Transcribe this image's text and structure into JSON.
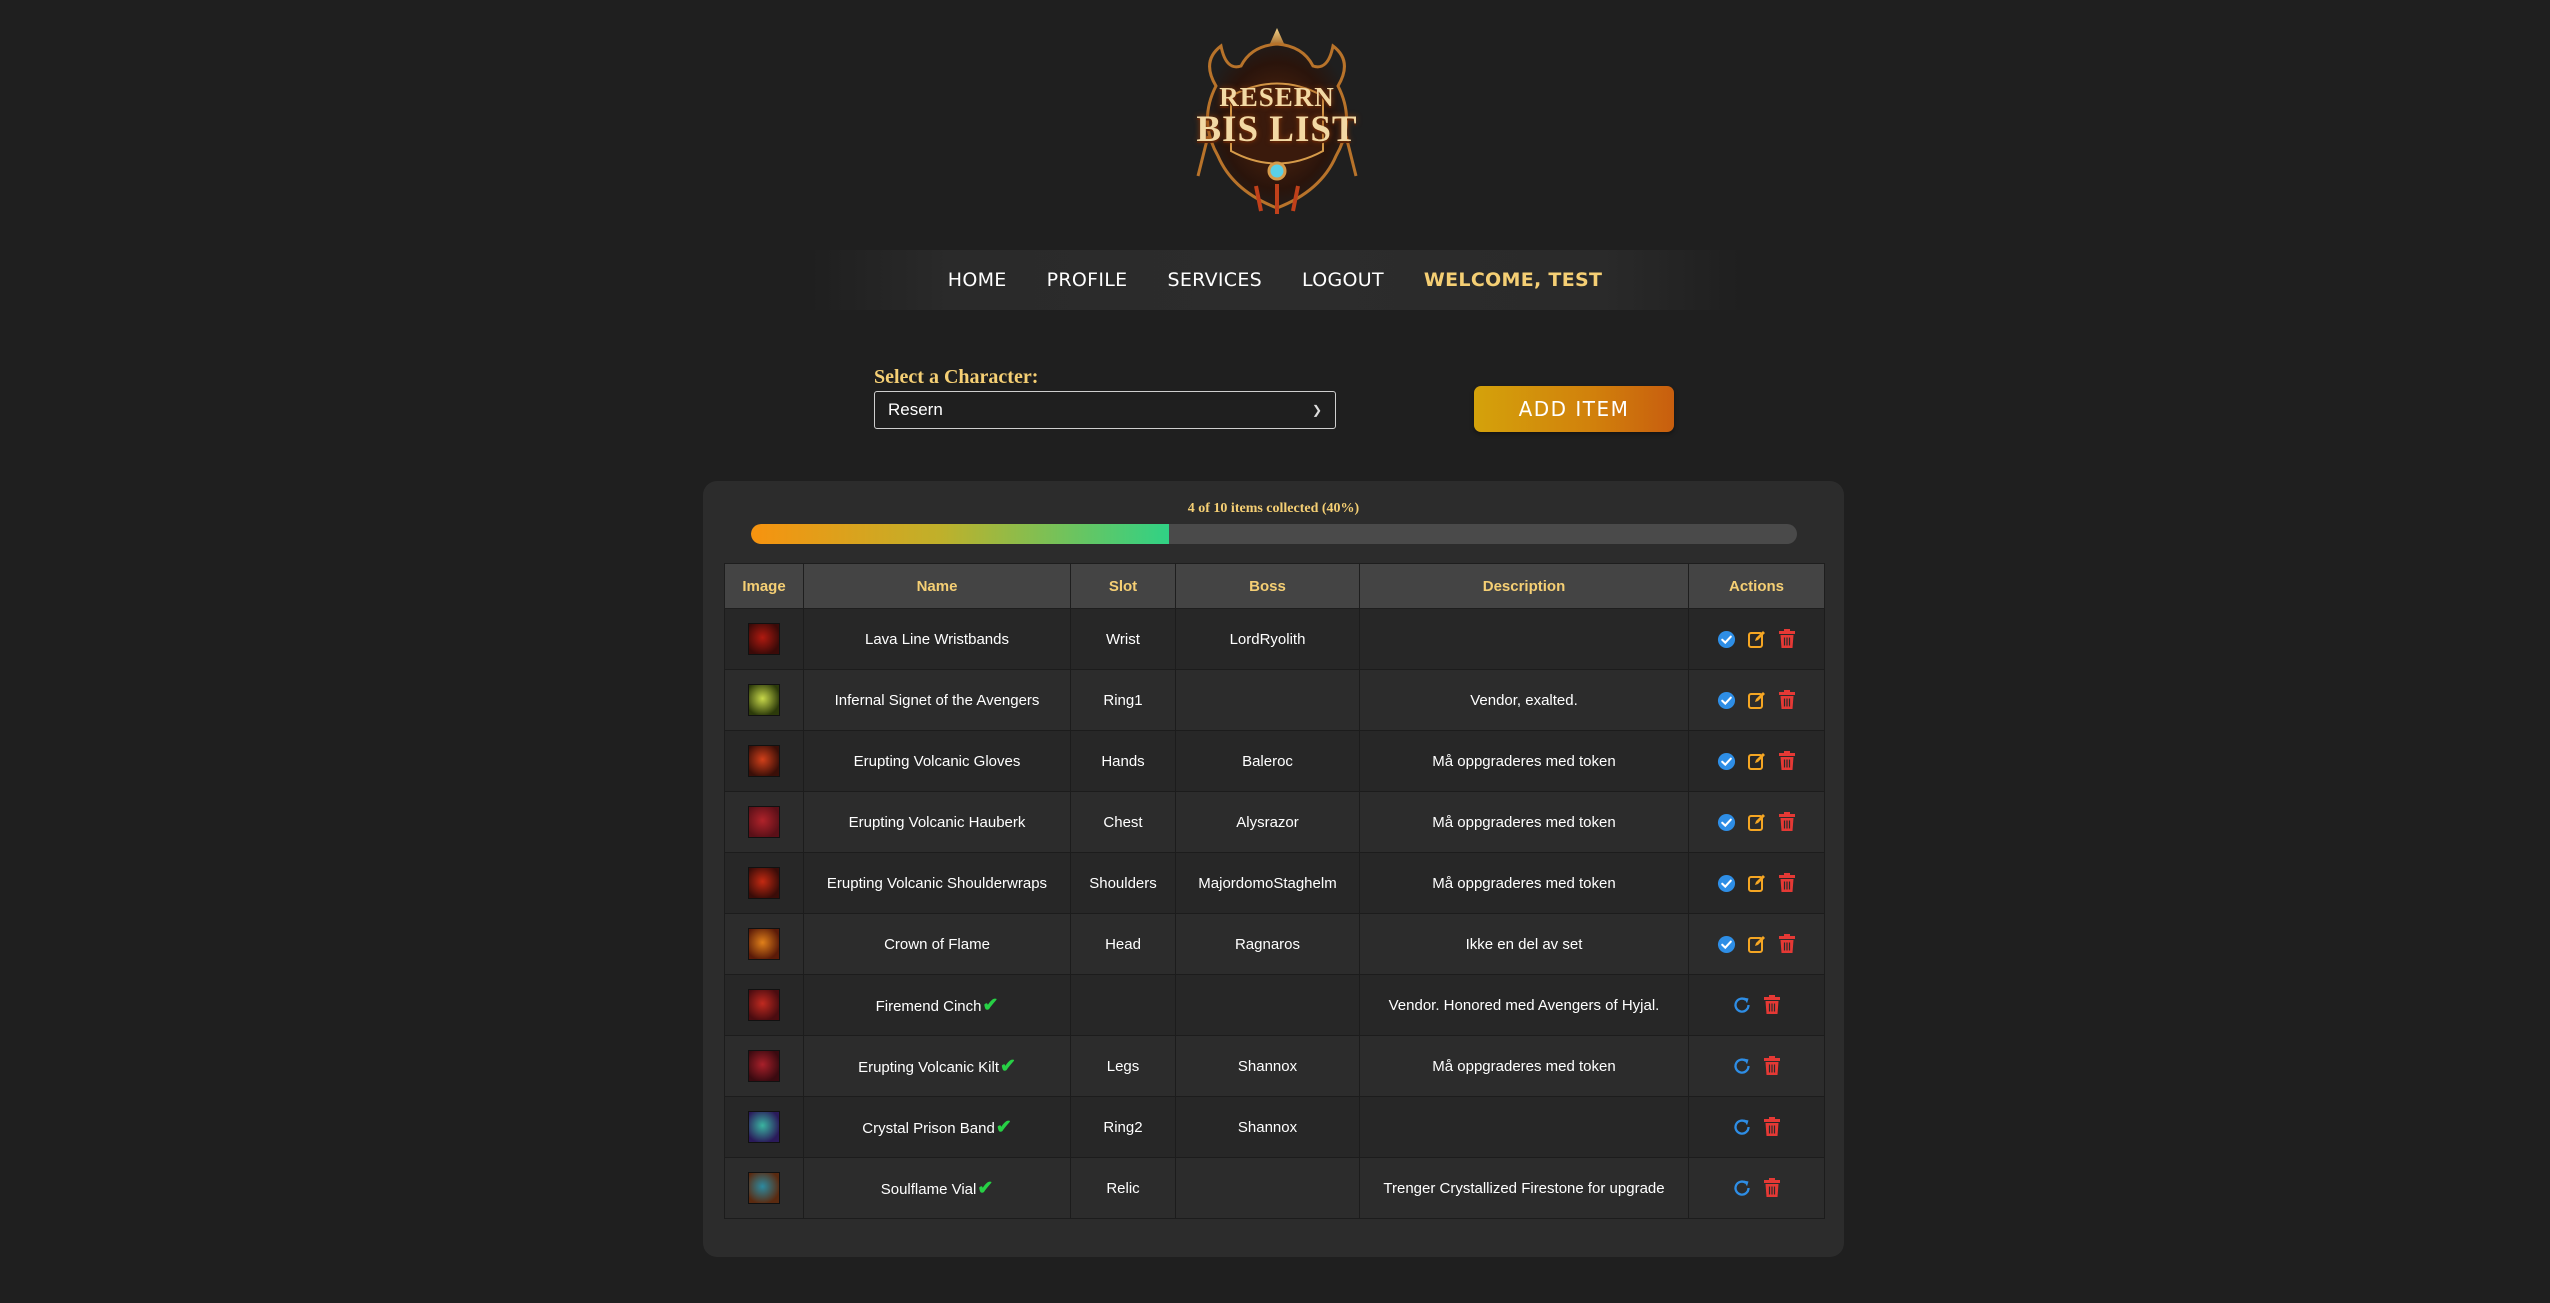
{
  "logo": {
    "line1": "RESERN",
    "line2": "BIS LIST"
  },
  "nav": {
    "home": "HOME",
    "profile": "PROFILE",
    "services": "SERVICES",
    "logout": "LOGOUT",
    "welcome": "WELCOME, TEST"
  },
  "character": {
    "label": "Select a Character:",
    "selected": "Resern"
  },
  "add_item_label": "ADD ITEM",
  "progress": {
    "text": "4 of 10 items collected (40%)",
    "collected": 4,
    "total": 10,
    "percent": 40
  },
  "table": {
    "headers": [
      "Image",
      "Name",
      "Slot",
      "Boss",
      "Description",
      "Actions"
    ],
    "rows": [
      {
        "name": "Lava Line Wristbands",
        "slot": "Wrist",
        "boss": "LordRyolith",
        "description": "",
        "collected": false,
        "icon": "wristbands-icon"
      },
      {
        "name": "Infernal Signet of the Avengers",
        "slot": "Ring1",
        "boss": "",
        "description": "Vendor, exalted.",
        "collected": false,
        "icon": "ring-icon"
      },
      {
        "name": "Erupting Volcanic Gloves",
        "slot": "Hands",
        "boss": "Baleroc",
        "description": "Må oppgraderes med token",
        "collected": false,
        "icon": "gloves-icon"
      },
      {
        "name": "Erupting Volcanic Hauberk",
        "slot": "Chest",
        "boss": "Alysrazor",
        "description": "Må oppgraderes med token",
        "collected": false,
        "icon": "chest-armor-icon"
      },
      {
        "name": "Erupting Volcanic Shoulderwraps",
        "slot": "Shoulders",
        "boss": "MajordomoStaghelm",
        "description": "Må oppgraderes med token",
        "collected": false,
        "icon": "shoulders-icon"
      },
      {
        "name": "Crown of Flame",
        "slot": "Head",
        "boss": "Ragnaros",
        "description": "Ikke en del av set",
        "collected": false,
        "icon": "crown-icon"
      },
      {
        "name": "Firemend Cinch",
        "slot": "",
        "boss": "",
        "description": "Vendor. Honored med Avengers of Hyjal.",
        "collected": true,
        "icon": "belt-icon"
      },
      {
        "name": "Erupting Volcanic Kilt",
        "slot": "Legs",
        "boss": "Shannox",
        "description": "Må oppgraderes med token",
        "collected": true,
        "icon": "legs-armor-icon"
      },
      {
        "name": "Crystal Prison Band",
        "slot": "Ring2",
        "boss": "Shannox",
        "description": "",
        "collected": true,
        "icon": "crystal-ring-icon"
      },
      {
        "name": "Soulflame Vial",
        "slot": "Relic",
        "boss": "",
        "description": "Trenger Crystallized Firestone for upgrade",
        "collected": true,
        "icon": "vial-icon"
      }
    ]
  },
  "colors": {
    "accent": "#f5cf74",
    "background": "#1f1f1f",
    "collect": "#2e8ee6",
    "edit": "#f5a623",
    "delete": "#e53935",
    "undo": "#2e8ee6",
    "check": "#27d045"
  }
}
